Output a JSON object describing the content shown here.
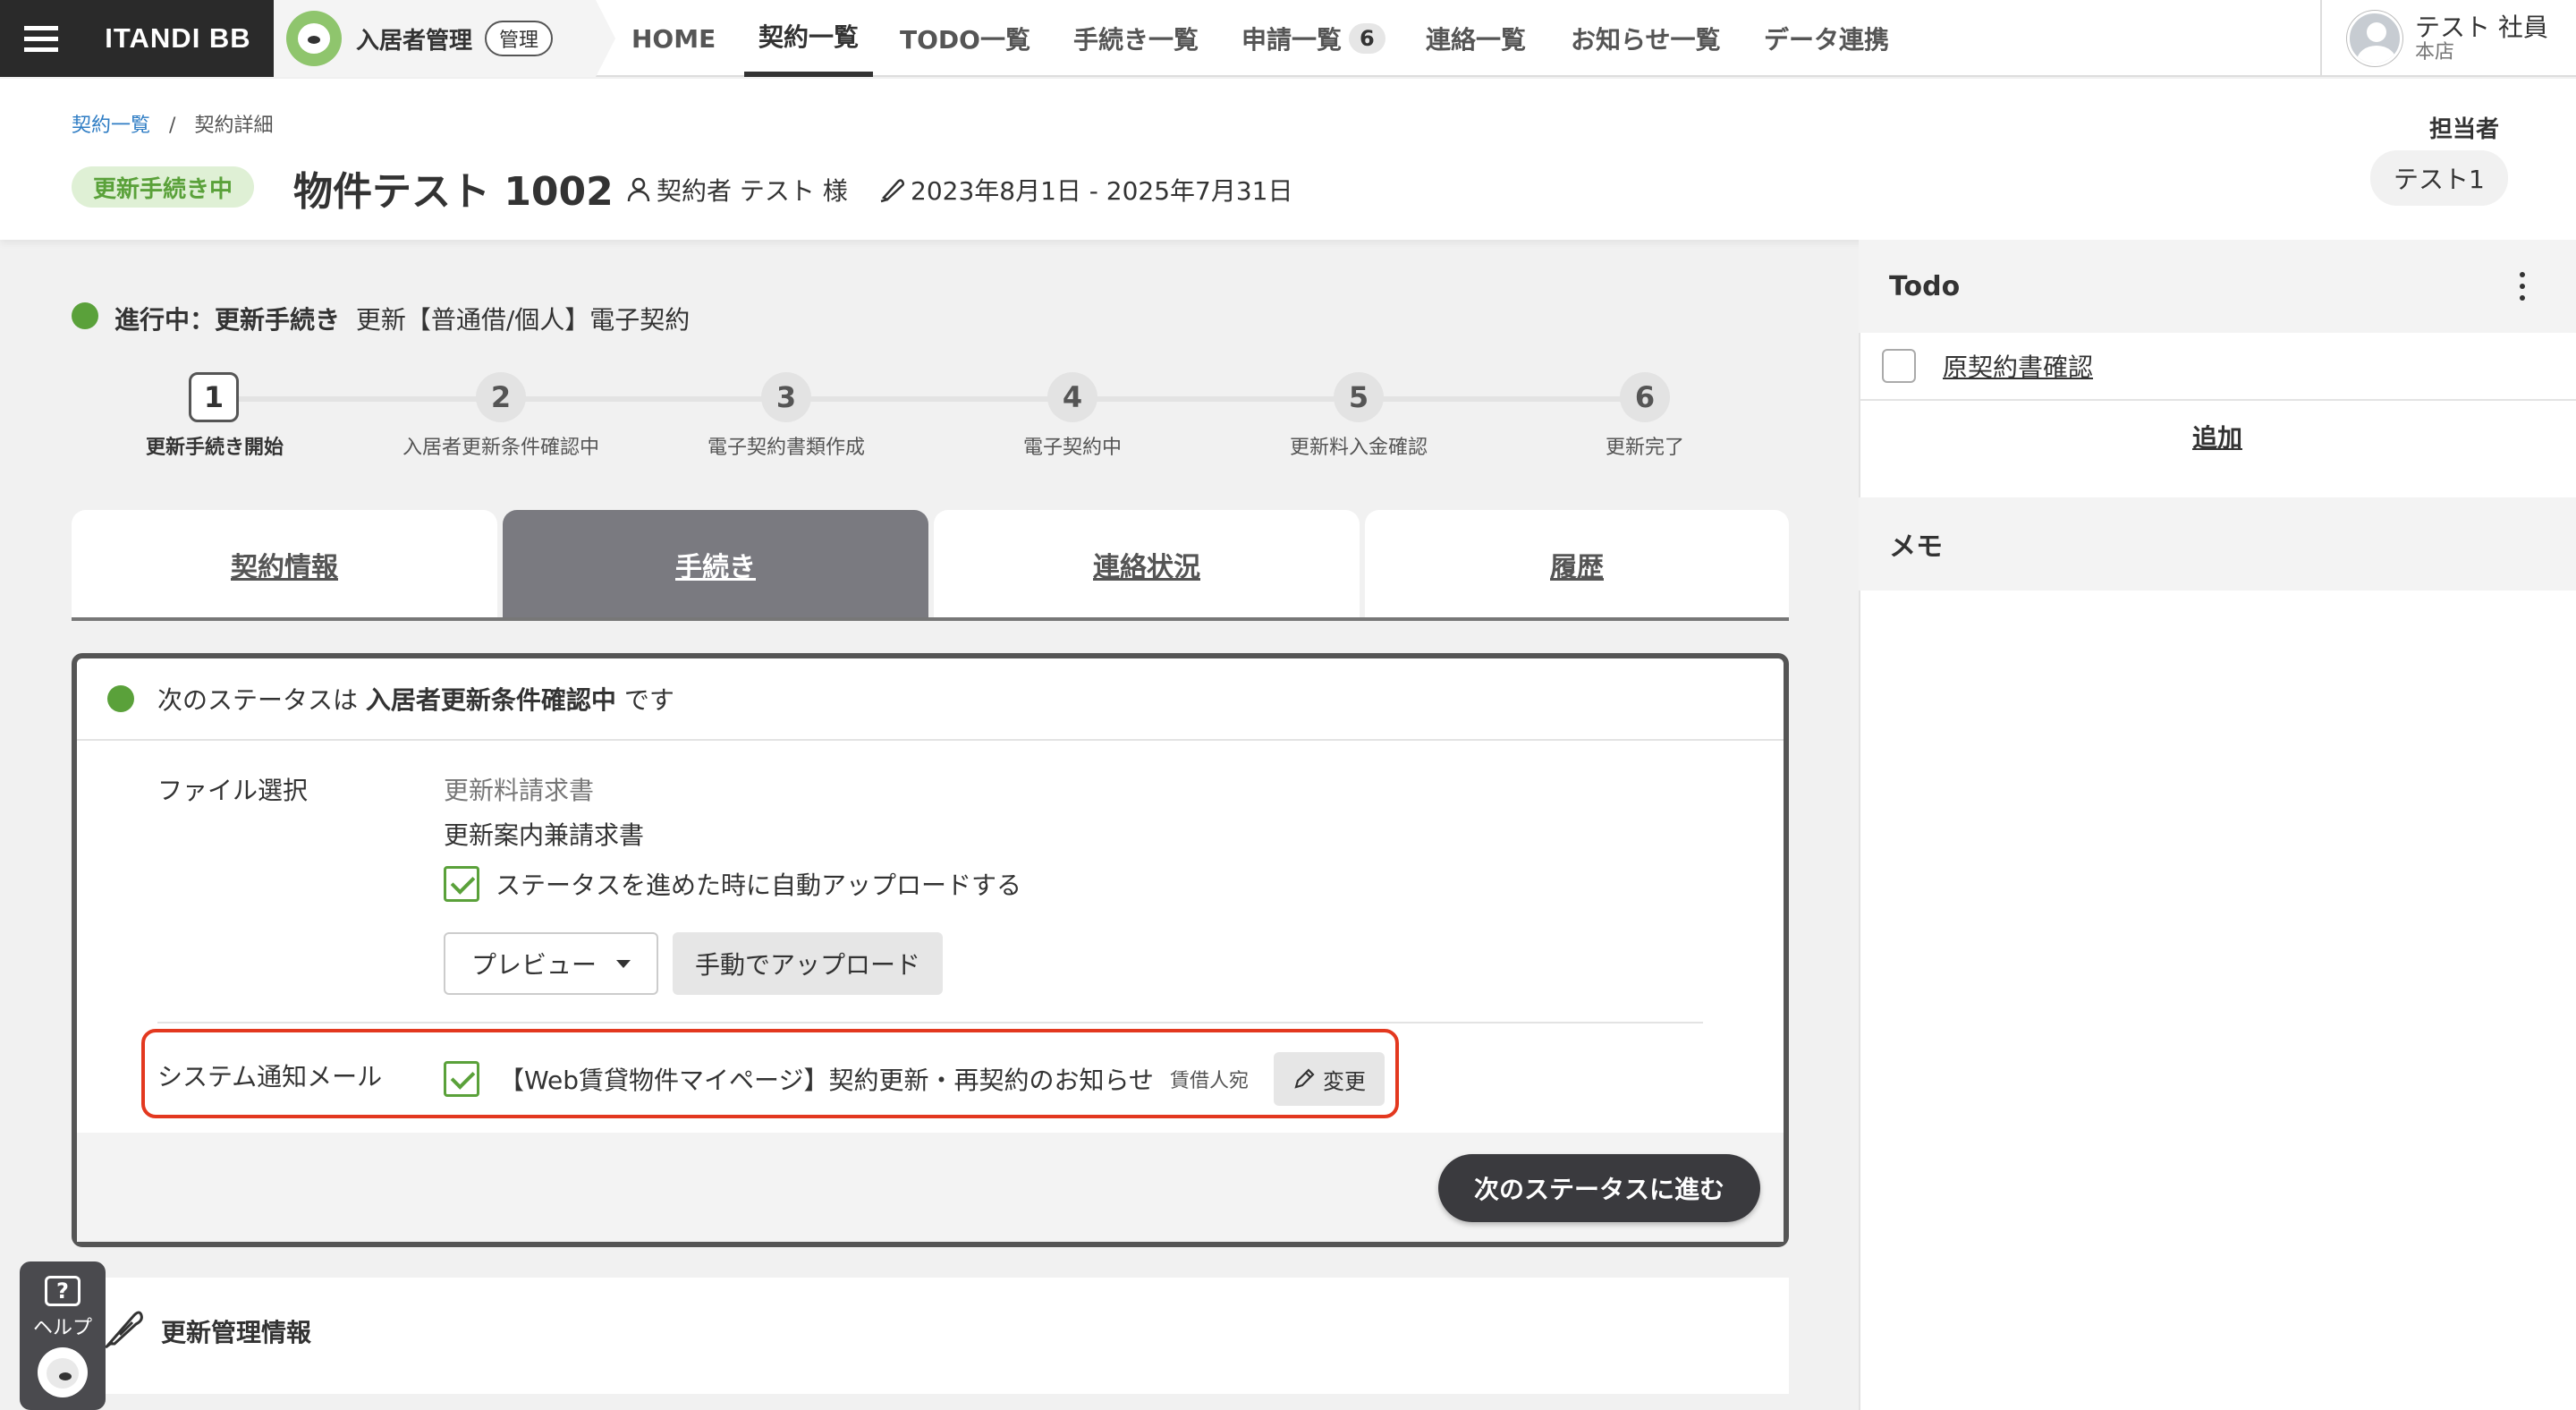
{
  "nav": {
    "brand": "ITANDI BB",
    "app_name": "入居者管理",
    "admin_badge": "管理",
    "items": [
      {
        "label": "HOME"
      },
      {
        "label": "契約一覧"
      },
      {
        "label": "TODO一覧"
      },
      {
        "label": "手続き一覧"
      },
      {
        "label": "申請一覧",
        "count": "6"
      },
      {
        "label": "連絡一覧"
      },
      {
        "label": "お知らせ一覧"
      },
      {
        "label": "データ連携"
      }
    ],
    "active_index": 1,
    "user": {
      "name": "テスト 社員",
      "branch": "本店"
    }
  },
  "breadcrumb": {
    "parent": "契約一覧",
    "sep": "/",
    "current": "契約詳細"
  },
  "header": {
    "status_tag": "更新手続き中",
    "property_title": "物件テスト 1002",
    "contractor": "契約者 テスト 様",
    "period": "2023年8月1日 - 2025年7月31日",
    "assignee_label": "担当者",
    "assignee": "テスト1"
  },
  "phase": {
    "status_bold": "進行中：更新手続き",
    "description": "更新【普通借/個人】電子契約"
  },
  "steps": [
    {
      "num": "1",
      "label": "更新手続き開始",
      "current": true
    },
    {
      "num": "2",
      "label": "入居者更新条件確認中"
    },
    {
      "num": "3",
      "label": "電子契約書類作成"
    },
    {
      "num": "4",
      "label": "電子契約中"
    },
    {
      "num": "5",
      "label": "更新料入金確認"
    },
    {
      "num": "6",
      "label": "更新完了"
    }
  ],
  "tabs": [
    {
      "label": "契約情報"
    },
    {
      "label": "手続き",
      "active": true
    },
    {
      "label": "連絡状況"
    },
    {
      "label": "履歴"
    }
  ],
  "card": {
    "next_status_prefix": "次のステータスは",
    "next_status": "入居者更新条件確認中",
    "next_status_suffix": "です",
    "file_label": "ファイル選択",
    "file_options": [
      "更新料請求書",
      "更新案内兼請求書"
    ],
    "auto_upload_label": "ステータスを進めた時に自動アップロードする",
    "preview_label": "プレビュー",
    "manual_upload_label": "手動でアップロード",
    "sys_mail_label": "システム通知メール",
    "sys_mail_text": "【Web賃貸物件マイページ】契約更新・再契約のお知らせ",
    "sys_mail_recipient": "賃借人宛",
    "change_label": "変更",
    "next_button": "次のステータスに進む"
  },
  "renewal": {
    "title": "更新管理情報"
  },
  "todo": {
    "title": "Todo",
    "items": [
      {
        "label": "原契約書確認",
        "checked": false
      }
    ],
    "add_label": "追加"
  },
  "memo": {
    "title": "メモ"
  },
  "help": {
    "label": "ヘルプ"
  },
  "colors": {
    "accent_green": "#5aa13a",
    "highlight_red": "#e3381f",
    "dark": "#2a2a2a"
  }
}
